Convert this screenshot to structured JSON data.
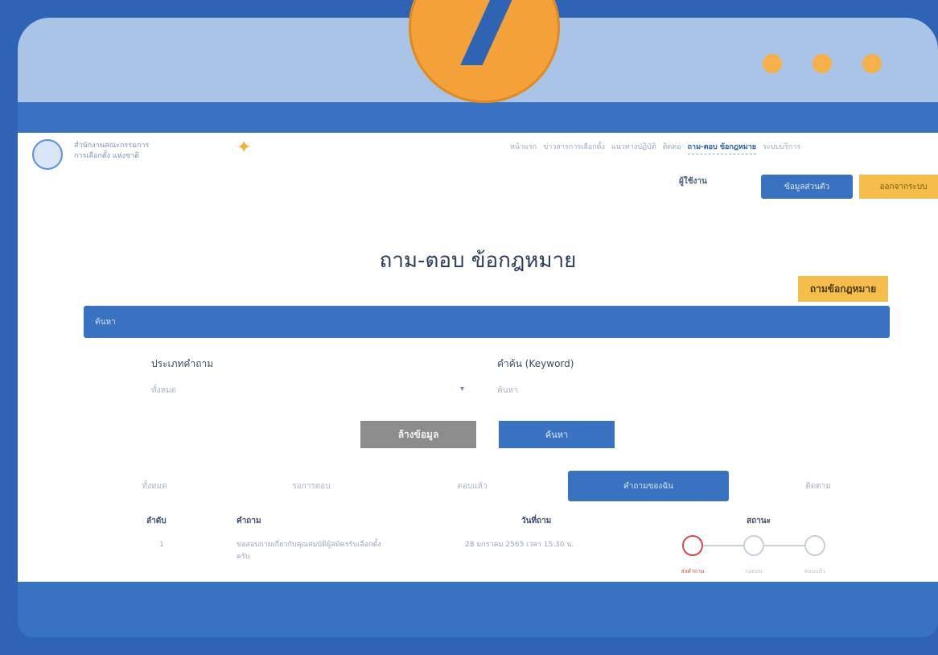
{
  "badge": {
    "number": "7"
  },
  "header": {
    "org_line1": "สำนักงานคณะกรรมการ",
    "org_line2": "การเลือกตั้ง แห่งชาติ",
    "nav": [
      "หน้าแรก",
      "ข่าวสารการเลือกตั้ง",
      "แนวทางปฏิบัติ",
      "ติดต่อ",
      "ถาม-ตอบ ข้อกฎหมาย",
      "ระบบบริการ"
    ],
    "active_nav_index": 4,
    "user_label": "ผู้ใช้งาน",
    "profile_button": "ข้อมูลส่วนตัว",
    "logout_button": "ออกจากระบบ"
  },
  "page": {
    "title": "ถาม-ตอบ ข้อกฎหมาย",
    "ask_button": "ถามข้อกฎหมาย",
    "search_bar_label": "ค้นหา"
  },
  "filters": {
    "category_label": "ประเภทคำถาม",
    "category_value": "ทั้งหมด",
    "keyword_label": "คำค้น (Keyword)",
    "keyword_placeholder": "ค้นหา",
    "reset_button": "ล้างข้อมูล",
    "search_button": "ค้นหา"
  },
  "tabs": [
    "ทั้งหมด",
    "รอการตอบ",
    "ตอบแล้ว",
    "คำถามของฉัน",
    "ติดตาม"
  ],
  "active_tab_index": 3,
  "table": {
    "headers": [
      "ลำดับ",
      "คำถาม",
      "วันที่ถาม",
      "สถานะ"
    ],
    "rows": [
      {
        "index": "1",
        "question": "ขอสอบถามเกี่ยวกับคุณสมบัติผู้สมัครรับเลือกตั้ง",
        "question_line2": "ครับ",
        "date": "28 มกราคม 2565 เวลา 15.30 น.",
        "status_steps": [
          "ส่งคำถาม",
          "รอตอบ",
          "ตอบแล้ว"
        ],
        "current_step": 0
      }
    ]
  },
  "colors": {
    "primary": "#3a72c2",
    "accent": "#f5bd49",
    "badge": "#f5a13a",
    "frame_bg": "#2f64b4"
  }
}
